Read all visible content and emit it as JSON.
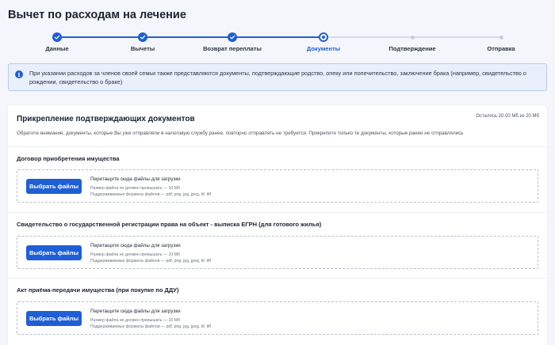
{
  "page": {
    "title": "Вычет по расходам на лечение"
  },
  "stepper": {
    "steps": [
      {
        "label": "Данные",
        "state": "done"
      },
      {
        "label": "Вычеты",
        "state": "done"
      },
      {
        "label": "Возврат переплаты",
        "state": "done"
      },
      {
        "label": "Документы",
        "state": "current"
      },
      {
        "label": "Подтверждение",
        "state": "todo"
      },
      {
        "label": "Отправка",
        "state": "todo"
      }
    ]
  },
  "info": {
    "icon": "info-icon",
    "text": "При указании расходов за членов своей семьи также представляются документы, подтверждающие родство, опеку или попечительство, заключение брака (например, свидетельство о рождении, свидетельство о браке)"
  },
  "card": {
    "title": "Прикрепление подтверждающих документов",
    "limit": "Осталось 20.00 Мб из 20 Мб",
    "note": "Обратите внимание, документы, которые Вы уже отправляли в налоговую службу ранее, повторно отправлять не требуется. Прикрепите только те документы, которые ранее не отправлялись"
  },
  "sections": [
    {
      "title": "Договор приобретения имущества",
      "button": "Выбрать файлы",
      "drop_title": "Перетащите сюда файлы для загрузки",
      "size_hint": "Размер файла не должен превышать — 10 Мб",
      "formats_hint": "Поддерживаемые форматы файлов — pdf, png, jpg, jpeg, tif, tiff"
    },
    {
      "title": "Свидетельство о государственной регистрации права на объект - выписка ЕГРН (для готового жилья)",
      "button": "Выбрать файлы",
      "drop_title": "Перетащите сюда файлы для загрузки",
      "size_hint": "Размер файла не должен превышать — 10 Мб",
      "formats_hint": "Поддерживаемые форматы файлов — pdf, png, jpg, jpeg, tif, tiff"
    },
    {
      "title": "Акт приёма-передачи имущества (при покупке по ДДУ)",
      "button": "Выбрать файлы",
      "drop_title": "Перетащите сюда файлы для загрузки",
      "size_hint": "Размер файла не должен превышать — 10 Мб",
      "formats_hint": "Поддерживаемые форматы файлов — pdf, png, jpg, jpeg, tif, tiff"
    }
  ],
  "colors": {
    "accent": "#1f5fd6",
    "info_bg": "#e9f0fc",
    "page_bg": "#f4f6fb"
  }
}
